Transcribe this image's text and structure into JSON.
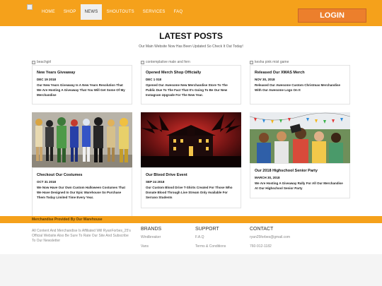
{
  "header": {
    "nav": [
      "HOME",
      "SHOP",
      "NEWS",
      "SHOUTOUTS",
      "SERVICES",
      "FAQ"
    ],
    "active_index": 2,
    "login_label": "LOGIN"
  },
  "posts_section": {
    "title": "LATEST POSTS",
    "subtitle": "Our Main Website Now Has Been Updated So Check It Out Today!"
  },
  "posts": [
    {
      "image_alt": "beachgirl",
      "title": "New Years Giveaway",
      "date": "DEC 19 2018",
      "text": "Our New Years Giveaway Is A New Years Resolution That We Are Hosting A Giveaway That You Will Get Some Of My Merchandise"
    },
    {
      "image_alt": "contemplative male and fern",
      "title": "Opened Merch Shop Officially",
      "date": "DEC 1 018",
      "text": "Opened Our Awesome New Merchandise Store To The Public Due To The Fact That It's Going To Be Our New Instagram Upgrade For The New Year."
    },
    {
      "image_alt": "kesha pink mist game",
      "title": "Released Our XMAS Merch",
      "date": "NOV 30, 2018",
      "text": "Released Our Awesome Custom Christmas Merchandise With Our Awesome Logo On It"
    },
    {
      "title": "Checkout Our Costumes",
      "date": "OCT 31 2018",
      "text": "We Now Have Our Own Custom Halloween Costumes That We Have Designed In Our Epic Warehouse So Purchase Them Today Limited Time Every Year."
    },
    {
      "title": "Our Blood Drive Event",
      "date": "SEP 24 2018",
      "text": "Our Custom Blood Drive T-Shirts Created For Those Who Donate Blood Through Live Stream Only Available For Serrano Students"
    },
    {
      "title": "Our 2018 Highschool Senior Party",
      "date": "MARCH 30, 2018",
      "text": "We Are Hosting A Giveaway Rally For All Our Merchandise At Our Highschool Senior Party"
    }
  ],
  "footer": {
    "bar_text": "Merchandise Provided By Our Warehouse",
    "about": "All Content And Merchandise Is Affiliated Will RyanForbes_25's Official Website Also Be Sure To Rate Our Site And Subscribe To Our Newsletter",
    "brands": {
      "heading": "BRANDS",
      "items": [
        "Windbreaker",
        "Vans"
      ]
    },
    "support": {
      "heading": "SUPPORT",
      "items": [
        "F.A.Q",
        "Terms & Conditions"
      ]
    },
    "contact": {
      "heading": "CONTACT",
      "items": [
        "ryan25forbes@gmail.com",
        "760-912-1182"
      ]
    }
  },
  "colors": {
    "accent": "#f5a11b",
    "login": "#ec7f2c"
  }
}
